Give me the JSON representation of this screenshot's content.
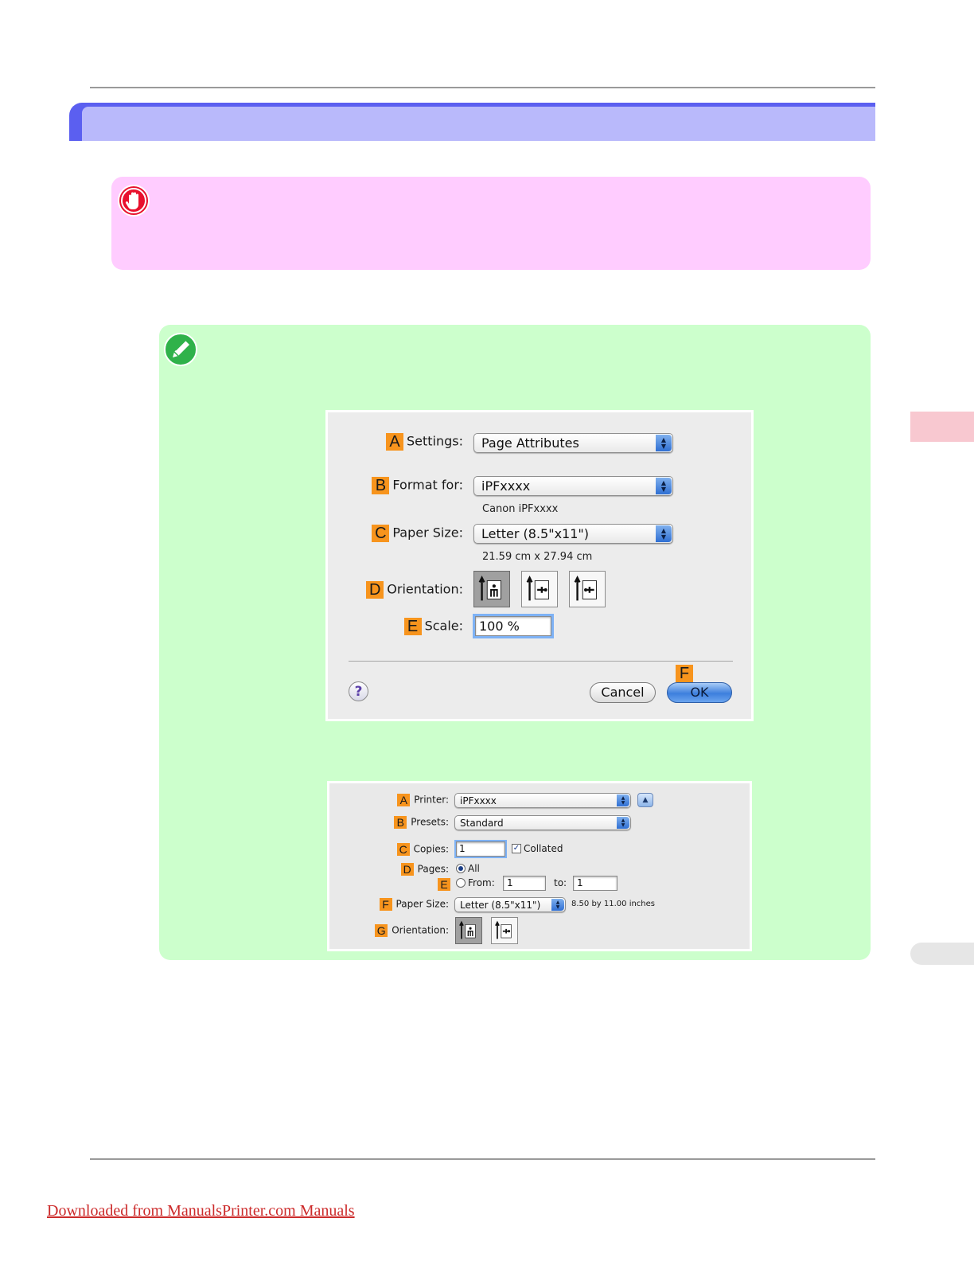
{
  "important": {
    "icon": "hand-stop-icon",
    "color": "#e8112d"
  },
  "note": {
    "icon": "pencil-icon",
    "color": "#2fb24a"
  },
  "page_setup_dialog": {
    "settings": {
      "badge": "A",
      "label": "Settings:",
      "value": "Page Attributes"
    },
    "format_for": {
      "badge": "B",
      "label": "Format for:",
      "value": "iPFxxxx",
      "sub": "Canon iPFxxxx"
    },
    "paper_size": {
      "badge": "C",
      "label": "Paper Size:",
      "value": "Letter (8.5\"x11\")",
      "sub": "21.59 cm x 27.94 cm"
    },
    "orientation": {
      "badge": "D",
      "label": "Orientation:",
      "selected": "portrait"
    },
    "scale": {
      "badge": "E",
      "label": "Scale:",
      "value": "100 %"
    },
    "ok_badge": "F",
    "help_label": "?",
    "cancel_label": "Cancel",
    "ok_label": "OK"
  },
  "print_dialog": {
    "printer": {
      "badge": "A",
      "label": "Printer:",
      "value": "iPFxxxx"
    },
    "presets": {
      "badge": "B",
      "label": "Presets:",
      "value": "Standard"
    },
    "copies": {
      "badge": "C",
      "label": "Copies:",
      "value": "1",
      "collated_label": "Collated",
      "collated": true
    },
    "pages": {
      "badge": "D",
      "label": "Pages:",
      "all_label": "All"
    },
    "from_row": {
      "badge": "E",
      "from_label": "From:",
      "from_value": "1",
      "to_label": "to:",
      "to_value": "1"
    },
    "paper_size": {
      "badge": "F",
      "label": "Paper Size:",
      "value": "Letter (8.5\"x11\")",
      "sub": "8.50 by 11.00 inches"
    },
    "orientation": {
      "badge": "G",
      "label": "Orientation:"
    }
  },
  "footer": {
    "link_text": "Downloaded from ManualsPrinter.com Manuals"
  }
}
